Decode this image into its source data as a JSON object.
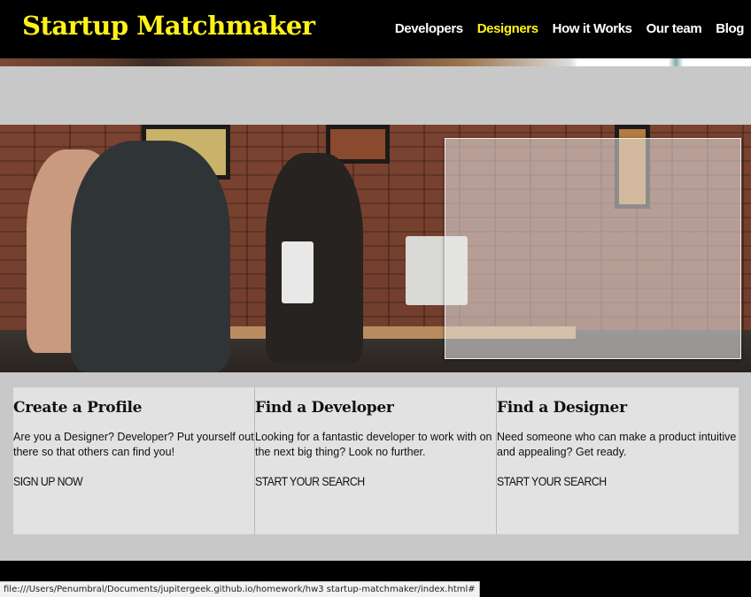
{
  "header": {
    "logo": "Startup Matchmaker",
    "nav": [
      {
        "label": "Developers",
        "active": false
      },
      {
        "label": "Designers",
        "active": true
      },
      {
        "label": "How it Works",
        "active": false
      },
      {
        "label": "Our team",
        "active": false
      },
      {
        "label": "Blog",
        "active": false
      }
    ]
  },
  "colors": {
    "accent": "#fff21a",
    "header_bg": "#000000",
    "card_bg": "#e2e2e2",
    "page_bg": "#c8c8c8"
  },
  "cards": [
    {
      "title": "Create a Profile",
      "body": "Are you a Designer? Developer? Put yourself out there so that others can find you!",
      "cta": "SIGN UP NOW"
    },
    {
      "title": "Find a Developer",
      "body": "Looking for a fantastic developer to work with on the next big thing? Look no further.",
      "cta": "START YOUR SEARCH"
    },
    {
      "title": "Find a Designer",
      "body": "Need someone who can make a product intuitive and appealing? Get ready.",
      "cta": "START YOUR SEARCH"
    }
  ],
  "status_bar": {
    "url": "file:///Users/Penumbral/Documents/jupitergeek.github.io/homework/hw3 startup-matchmaker/index.html#"
  }
}
